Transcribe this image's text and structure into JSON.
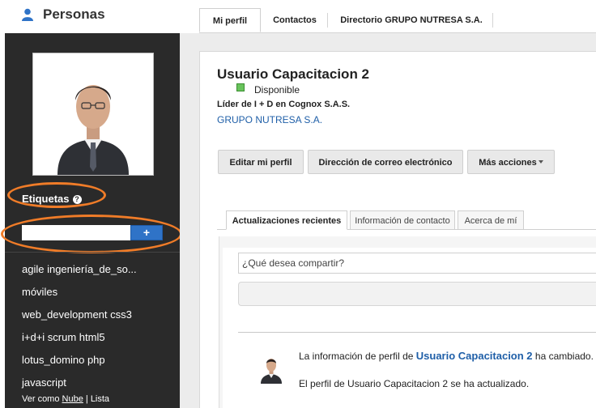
{
  "app": {
    "title": "Personas",
    "icon": "person-icon"
  },
  "top_tabs": [
    {
      "label": "Mi perfil",
      "active": true
    },
    {
      "label": "Contactos",
      "active": false
    },
    {
      "label": "Directorio GRUPO NUTRESA S.A.",
      "active": false
    }
  ],
  "sidebar": {
    "tags_heading": "Etiquetas",
    "help_icon": "?",
    "add_button": "+",
    "tags": [
      "agile ingeniería_de_so...",
      "móviles",
      "web_development css3",
      "i+d+i scrum html5",
      "lotus_domino php",
      "javascript"
    ],
    "view_as": {
      "prefix": "Ver como",
      "cloud": "Nube",
      "separator": "|",
      "list": "Lista"
    }
  },
  "profile": {
    "name": "Usuario Capacitacion 2",
    "status": "Disponible",
    "status_color": "#68c35c",
    "job_title": "Líder de I + D en Cognox S.A.S.",
    "organization": "GRUPO NUTRESA S.A."
  },
  "actions": {
    "edit": "Editar mi perfil",
    "email": "Dirección de correo electrónico",
    "more": "Más acciones"
  },
  "sub_tabs": [
    {
      "label": "Actualizaciones recientes",
      "active": true
    },
    {
      "label": "Información de contacto",
      "active": false
    },
    {
      "label": "Acerca de mí",
      "active": false
    }
  ],
  "feed": {
    "share_placeholder": "¿Qué desea compartir?",
    "entry": {
      "prefix": "La información de perfil de",
      "name": "Usuario Capacitacion 2",
      "suffix": "ha cambiado.",
      "detail": "El perfil de Usuario Capacitacion 2 se ha actualizado."
    }
  },
  "colors": {
    "sidebar": "#2a2a2a",
    "accent_blue": "#2f73c7",
    "link": "#1f5fa8",
    "highlight": "#f07c28"
  }
}
